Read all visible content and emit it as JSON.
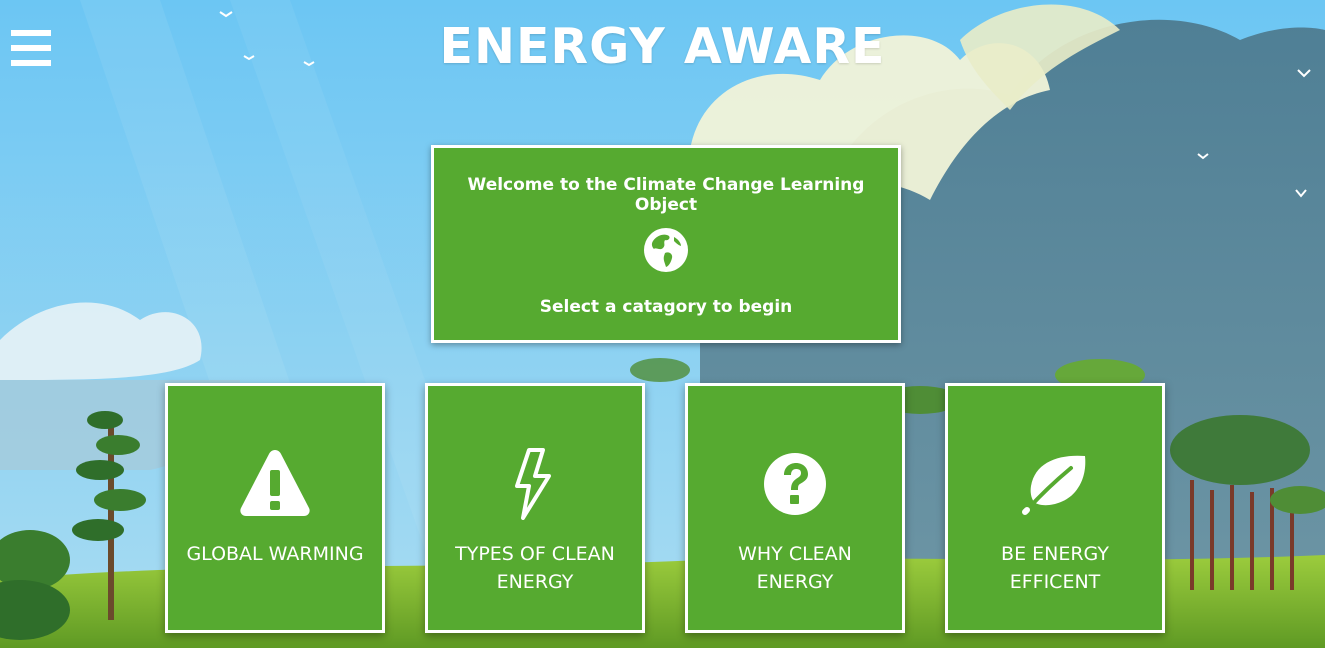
{
  "header": {
    "title": "ENERGY AWARE",
    "menu_icon": "hamburger-menu-icon"
  },
  "welcome": {
    "heading": "Welcome to the Climate Change Learning Object",
    "icon": "globe-icon",
    "subheading": "Select a catagory to begin"
  },
  "categories": [
    {
      "label": "GLOBAL WARMING",
      "icon": "warning-icon"
    },
    {
      "label": "TYPES OF CLEAN ENERGY",
      "icon": "lightning-bolt-icon"
    },
    {
      "label": "WHY CLEAN ENERGY",
      "icon": "question-circle-icon"
    },
    {
      "label": "BE ENERGY EFFICENT",
      "icon": "leaf-icon"
    }
  ],
  "colors": {
    "card_green": "#56aa30",
    "card_border": "#ffffff",
    "sky": "#7fcdf5",
    "text": "#ffffff"
  }
}
